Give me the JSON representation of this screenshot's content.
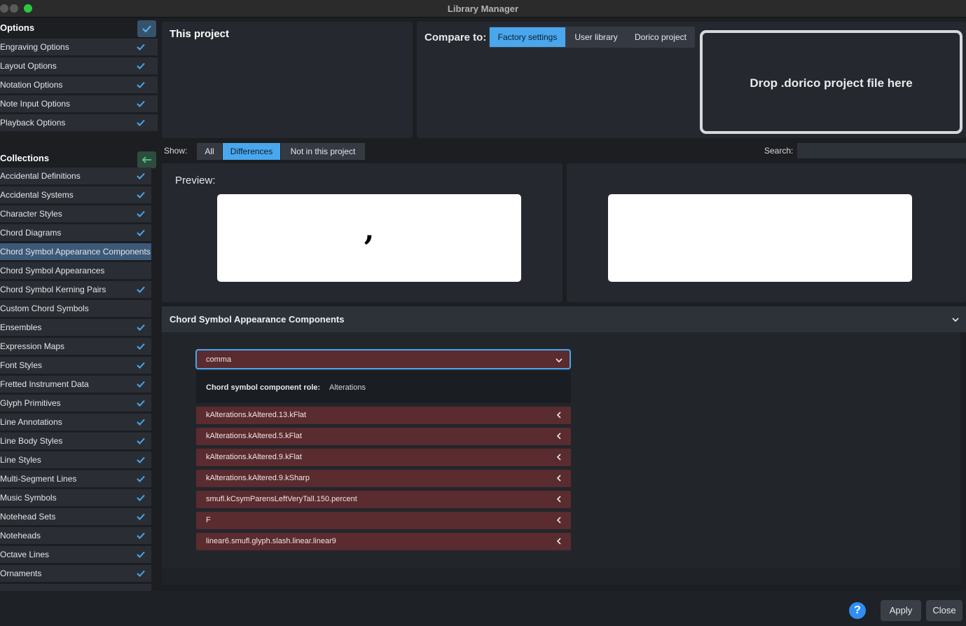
{
  "window": {
    "title": "Library Manager"
  },
  "colors": {
    "accent": "#4aa6ed",
    "difference_row": "#5a2b2f",
    "selected_row": "#3c5a78"
  },
  "sidebar": {
    "options_header": "Options",
    "options": [
      {
        "label": "Engraving Options",
        "checked": true
      },
      {
        "label": "Layout Options",
        "checked": true
      },
      {
        "label": "Notation Options",
        "checked": true
      },
      {
        "label": "Note Input Options",
        "checked": true
      },
      {
        "label": "Playback Options",
        "checked": true
      }
    ],
    "collections_header": "Collections",
    "collections": [
      {
        "label": "Accidental Definitions",
        "checked": true
      },
      {
        "label": "Accidental Systems",
        "checked": true
      },
      {
        "label": "Character Styles",
        "checked": true
      },
      {
        "label": "Chord Diagrams",
        "checked": true
      },
      {
        "label": "Chord Symbol Appearance Components",
        "checked": false,
        "selected": true
      },
      {
        "label": "Chord Symbol Appearances",
        "checked": false
      },
      {
        "label": "Chord Symbol Kerning Pairs",
        "checked": true
      },
      {
        "label": "Custom Chord Symbols",
        "checked": false
      },
      {
        "label": "Ensembles",
        "checked": true
      },
      {
        "label": "Expression Maps",
        "checked": true
      },
      {
        "label": "Font Styles",
        "checked": true
      },
      {
        "label": "Fretted Instrument Data",
        "checked": true
      },
      {
        "label": "Glyph Primitives",
        "checked": true
      },
      {
        "label": "Line Annotations",
        "checked": true
      },
      {
        "label": "Line Body Styles",
        "checked": true
      },
      {
        "label": "Line Styles",
        "checked": true
      },
      {
        "label": "Multi-Segment Lines",
        "checked": true
      },
      {
        "label": "Music Symbols",
        "checked": true
      },
      {
        "label": "Notehead Sets",
        "checked": true
      },
      {
        "label": "Noteheads",
        "checked": true
      },
      {
        "label": "Octave Lines",
        "checked": true
      },
      {
        "label": "Ornaments",
        "checked": true
      }
    ]
  },
  "project": {
    "title": "This project"
  },
  "compare": {
    "label": "Compare to:",
    "tabs": [
      "Factory settings",
      "User library",
      "Dorico project"
    ],
    "active_tab": "Factory settings",
    "drop_text": "Drop .dorico project file here"
  },
  "filter": {
    "show_label": "Show:",
    "tabs": [
      "All",
      "Differences",
      "Not in this project"
    ],
    "active_tab": "Differences",
    "search_label": "Search:",
    "search_value": ""
  },
  "preview": {
    "label": "Preview:",
    "left_glyph": ","
  },
  "details": {
    "section_title": "Chord Symbol Appearance Components",
    "selected_component": "comma",
    "role_label": "Chord symbol component role:",
    "role_value": "Alterations",
    "components": [
      "kAlterations.kAltered.13.kFlat",
      "kAlterations.kAltered.5.kFlat",
      "kAlterations.kAltered.9.kFlat",
      "kAlterations.kAltered.9.kSharp",
      "smufl.kCsymParensLeftVeryTall.150.percent",
      "F",
      "linear6.smufl.glyph.slash.linear.linear9"
    ]
  },
  "footer": {
    "help": "?",
    "apply": "Apply",
    "close": "Close"
  }
}
